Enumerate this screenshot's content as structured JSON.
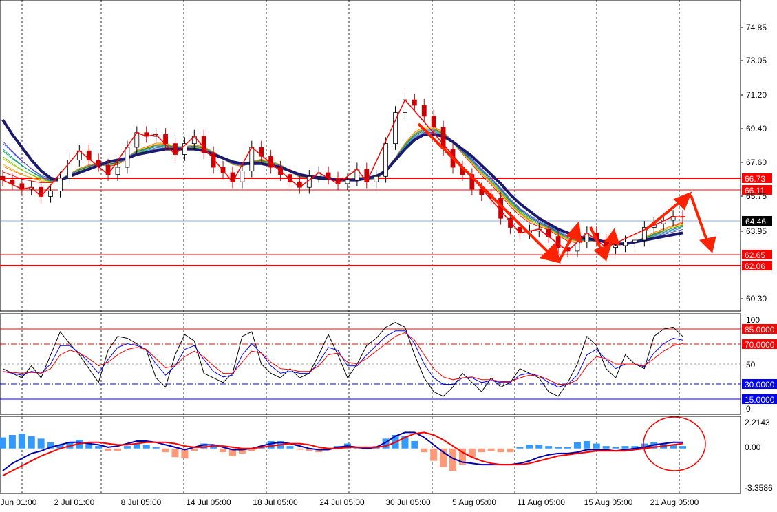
{
  "chart_data": [
    {
      "type": "candlestick",
      "panel": "price",
      "ylim": [
        59.5,
        76.0
      ],
      "y_ticks": [
        "74.85",
        "73.05",
        "71.20",
        "69.40",
        "67.60",
        "65.75",
        "63.95",
        "60.30"
      ],
      "x_ticks": [
        "Jun 01:00",
        "2 Jul 01:00",
        "8 Jul 05:00",
        "14 Jul 05:00",
        "18 Jul 05:00",
        "24 Jul 05:00",
        "30 Jul 05:00",
        "5 Aug 05:00",
        "11 Aug 05:00",
        "15 Aug 05:00",
        "21 Aug 05:00"
      ],
      "current_price": {
        "value": 64.46,
        "label": "64.46"
      },
      "levels": [
        {
          "value": 66.73,
          "label": "66.73",
          "color": "#ff0000"
        },
        {
          "value": 66.11,
          "label": "66.11",
          "color": "#ff0000"
        },
        {
          "value": 62.65,
          "label": "62.65",
          "color": "#ff0000"
        },
        {
          "value": 62.06,
          "label": "62.06",
          "color": "#ff0000"
        }
      ],
      "series": [
        {
          "name": "close",
          "values": [
            66.5,
            66.3,
            66.0,
            66.1,
            65.6,
            65.9,
            66.6,
            67.6,
            68.1,
            67.6,
            67.3,
            66.8,
            67.2,
            68.3,
            69.1,
            68.9,
            69.0,
            68.5,
            67.9,
            68.5,
            68.9,
            68.0,
            67.2,
            66.9,
            66.4,
            67.0,
            68.3,
            67.8,
            67.2,
            66.8,
            66.4,
            66.1,
            66.7,
            66.9,
            66.6,
            66.3,
            66.5,
            67.1,
            66.4,
            66.7,
            68.5,
            70.2,
            70.9,
            70.6,
            70.0,
            69.4,
            68.2,
            67.2,
            66.8,
            66.0,
            65.7,
            65.5,
            64.4,
            63.9,
            63.6,
            63.7,
            63.8,
            63.4,
            62.8,
            62.6,
            63.1,
            63.6,
            63.2,
            62.8,
            62.9,
            63.1,
            63.2,
            63.9,
            64.1,
            64.3,
            64.5,
            64.46
          ]
        },
        {
          "name": "ma-fast",
          "values": [
            67.0,
            66.8,
            66.6,
            66.5,
            66.4,
            66.4,
            66.5,
            66.8,
            67.1,
            67.3,
            67.4,
            67.3,
            67.4,
            67.7,
            68.1,
            68.3,
            68.5,
            68.5,
            68.3,
            68.3,
            68.4,
            68.3,
            68.0,
            67.7,
            67.4,
            67.3,
            67.5,
            67.6,
            67.5,
            67.3,
            67.0,
            66.7,
            66.7,
            66.7,
            66.6,
            66.5,
            66.5,
            66.6,
            66.6,
            66.6,
            67.0,
            67.7,
            68.5,
            69.1,
            69.4,
            69.4,
            69.1,
            68.6,
            68.0,
            67.4,
            66.8,
            66.3,
            65.7,
            65.1,
            64.6,
            64.2,
            64.0,
            63.8,
            63.5,
            63.2,
            63.1,
            63.2,
            63.2,
            63.1,
            63.0,
            63.0,
            63.1,
            63.3,
            63.6,
            63.8,
            64.0,
            64.2
          ]
        },
        {
          "name": "ma-slow",
          "values": [
            69.8,
            69.0,
            68.3,
            67.6,
            67.0,
            66.6,
            66.5,
            66.7,
            66.9,
            67.1,
            67.3,
            67.5,
            67.6,
            67.7,
            67.9,
            68.0,
            68.1,
            68.2,
            68.2,
            68.2,
            68.2,
            68.1,
            67.9,
            67.7,
            67.5,
            67.4,
            67.4,
            67.4,
            67.3,
            67.2,
            67.0,
            66.8,
            66.7,
            66.6,
            66.6,
            66.5,
            66.5,
            66.5,
            66.6,
            66.7,
            67.0,
            67.6,
            68.2,
            68.7,
            69.0,
            69.0,
            68.9,
            68.6,
            68.2,
            67.8,
            67.3,
            66.8,
            66.3,
            65.7,
            65.2,
            64.8,
            64.4,
            64.1,
            63.8,
            63.6,
            63.4,
            63.3,
            63.2,
            63.1,
            63.0,
            63.0,
            63.1,
            63.2,
            63.3,
            63.4,
            63.5,
            63.6
          ]
        }
      ]
    },
    {
      "type": "line",
      "panel": "stochastic",
      "ylim": [
        0,
        100
      ],
      "y_ticks": [
        "100",
        "50",
        "0"
      ],
      "levels": [
        {
          "value": 85,
          "label": "85.0000",
          "color": "#ff0000"
        },
        {
          "value": 70,
          "label": "70.0000",
          "color": "#ff0000"
        },
        {
          "value": 30,
          "label": "30.0000",
          "color": "#0000ff"
        },
        {
          "value": 15,
          "label": "15.0000",
          "color": "#0000ff"
        }
      ],
      "series": [
        {
          "name": "fast",
          "values": [
            45,
            40,
            35,
            48,
            35,
            60,
            85,
            72,
            60,
            45,
            30,
            65,
            80,
            78,
            72,
            65,
            35,
            25,
            60,
            82,
            75,
            40,
            35,
            30,
            40,
            80,
            85,
            50,
            40,
            35,
            45,
            35,
            40,
            60,
            82,
            60,
            35,
            50,
            70,
            78,
            90,
            95,
            90,
            60,
            35,
            20,
            15,
            25,
            40,
            30,
            20,
            35,
            25,
            30,
            45,
            40,
            35,
            20,
            15,
            30,
            50,
            80,
            70,
            45,
            35,
            60,
            50,
            45,
            80,
            88,
            90,
            80
          ]
        },
        {
          "name": "signal",
          "values": [
            42,
            40,
            38,
            42,
            40,
            50,
            70,
            70,
            62,
            52,
            40,
            55,
            68,
            72,
            70,
            66,
            50,
            38,
            48,
            66,
            70,
            55,
            42,
            36,
            38,
            60,
            72,
            62,
            48,
            40,
            42,
            40,
            40,
            52,
            68,
            65,
            48,
            48,
            60,
            70,
            80,
            86,
            86,
            72,
            50,
            35,
            28,
            28,
            35,
            35,
            30,
            32,
            30,
            30,
            38,
            40,
            37,
            30,
            25,
            28,
            38,
            60,
            66,
            55,
            45,
            50,
            50,
            47,
            62,
            72,
            78,
            76
          ]
        },
        {
          "name": "slow",
          "values": [
            42,
            41,
            40,
            41,
            40,
            45,
            60,
            65,
            62,
            56,
            48,
            52,
            60,
            66,
            68,
            66,
            56,
            46,
            48,
            58,
            64,
            58,
            48,
            40,
            40,
            52,
            64,
            62,
            52,
            45,
            44,
            42,
            42,
            48,
            60,
            62,
            52,
            50,
            56,
            64,
            72,
            80,
            84,
            76,
            60,
            45,
            36,
            33,
            35,
            36,
            33,
            33,
            31,
            31,
            35,
            38,
            37,
            33,
            28,
            28,
            33,
            48,
            58,
            56,
            50,
            50,
            50,
            48,
            56,
            64,
            70,
            72
          ]
        }
      ]
    },
    {
      "type": "bar",
      "panel": "macd",
      "ylim": [
        -3.3586,
        2.2143
      ],
      "y_ticks": [
        "2.2143",
        "0.00",
        "-3.3586"
      ],
      "series": [
        {
          "name": "histogram",
          "values": [
            0.9,
            1.1,
            1.2,
            1.0,
            0.8,
            0.5,
            0.3,
            0.5,
            0.7,
            0.5,
            0.2,
            -0.2,
            -0.2,
            0.2,
            0.4,
            0.3,
            0.1,
            -0.3,
            -0.7,
            -0.8,
            -0.2,
            0.4,
            0.2,
            -0.3,
            -0.6,
            -0.4,
            -0.2,
            0.2,
            0.6,
            0.6,
            0.2,
            -0.1,
            -0.2,
            -0.3,
            -0.1,
            0.2,
            0.4,
            0.1,
            0.0,
            0.2,
            0.8,
            1.1,
            1.0,
            0.6,
            -0.3,
            -1.0,
            -1.5,
            -1.8,
            -1.3,
            -0.7,
            -0.3,
            -0.2,
            -0.3,
            -0.3,
            0.1,
            0.3,
            0.3,
            0.2,
            0.1,
            0.1,
            0.5,
            0.6,
            0.4,
            0.2,
            0.1,
            0.2,
            0.2,
            0.4,
            0.5,
            0.4,
            0.3,
            0.2
          ]
        },
        {
          "name": "macd",
          "values": [
            -1.8,
            -1.2,
            -0.8,
            -0.4,
            -0.2,
            0.1,
            0.3,
            0.5,
            0.5,
            0.4,
            0.3,
            0.1,
            0.2,
            0.4,
            0.6,
            0.6,
            0.5,
            0.3,
            0.1,
            -0.1,
            0.1,
            0.3,
            0.3,
            0.1,
            -0.1,
            -0.1,
            0.0,
            0.2,
            0.4,
            0.5,
            0.4,
            0.2,
            0.0,
            -0.1,
            -0.1,
            0.1,
            0.2,
            0.1,
            0.0,
            0.1,
            0.5,
            1.0,
            1.3,
            1.3,
            0.9,
            0.3,
            -0.3,
            -0.8,
            -1.1,
            -1.2,
            -1.3,
            -1.3,
            -1.3,
            -1.3,
            -1.2,
            -1.0,
            -0.7,
            -0.5,
            -0.4,
            -0.4,
            -0.3,
            -0.1,
            -0.1,
            -0.1,
            -0.2,
            -0.1,
            0.0,
            0.1,
            0.3,
            0.4,
            0.5,
            0.5
          ]
        },
        {
          "name": "signal",
          "values": [
            -2.2,
            -1.8,
            -1.4,
            -1.0,
            -0.6,
            -0.3,
            0.0,
            0.2,
            0.4,
            0.5,
            0.5,
            0.4,
            0.3,
            0.3,
            0.4,
            0.5,
            0.5,
            0.5,
            0.4,
            0.2,
            0.1,
            0.1,
            0.2,
            0.2,
            0.1,
            0.0,
            0.0,
            0.1,
            0.2,
            0.3,
            0.4,
            0.4,
            0.3,
            0.1,
            0.0,
            0.0,
            0.1,
            0.1,
            0.1,
            0.1,
            0.2,
            0.5,
            0.9,
            1.2,
            1.3,
            1.1,
            0.7,
            0.2,
            -0.3,
            -0.7,
            -1.0,
            -1.2,
            -1.3,
            -1.3,
            -1.3,
            -1.2,
            -1.0,
            -0.8,
            -0.6,
            -0.5,
            -0.4,
            -0.3,
            -0.2,
            -0.2,
            -0.2,
            -0.2,
            -0.1,
            0.0,
            0.1,
            0.2,
            0.3,
            0.4
          ]
        }
      ]
    }
  ],
  "colors": {
    "up": "#000000",
    "down": "#cc0000",
    "zigzag": "#ff0000",
    "ma_slow": "#1a1a6e",
    "stoch_fast": "#000000",
    "stoch_signal": "#0000ff",
    "stoch_slow": "#ff0000",
    "hist_pos": "#3399ff",
    "hist_neg": "#ff9977",
    "macd": "#0000aa",
    "macd_signal": "#ff0000"
  }
}
